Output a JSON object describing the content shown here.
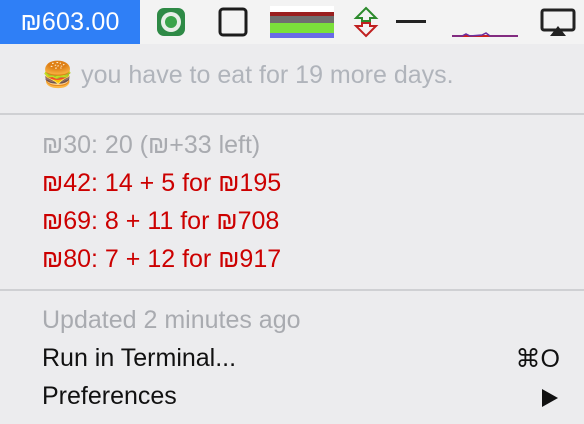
{
  "menubar": {
    "title": "₪603.00",
    "icons": [
      "app-green-circle-icon",
      "window-square-icon",
      "graph-strip-icon",
      "network-updown-icon",
      "dash-icon",
      "activity-graph-icon",
      "airplay-icon"
    ]
  },
  "menu": {
    "food_emoji": "🍔",
    "food_text": "you have to eat for 19 more days.",
    "price_lines": [
      {
        "text": "₪30: 20 (₪+33 left)",
        "color": "#a9abb0"
      },
      {
        "text": "₪42: 14 + 5 for ₪195",
        "color": "#cc0000"
      },
      {
        "text": "₪69: 8 + 11 for ₪708",
        "color": "#cc0000"
      },
      {
        "text": "₪80: 7 + 12 for ₪917",
        "color": "#cc0000"
      }
    ],
    "updated": "Updated 2 minutes ago",
    "run_in_terminal": "Run in Terminal...",
    "run_shortcut": "⌘O",
    "preferences": "Preferences"
  }
}
